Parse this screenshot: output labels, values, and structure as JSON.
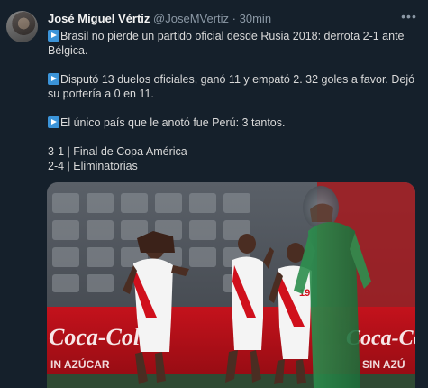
{
  "tweet": {
    "author_name": "José Miguel Vértiz",
    "author_handle": "@JoseMVertiz",
    "separator": "·",
    "timestamp": "30min",
    "more_icon": "more-icon",
    "paragraphs": [
      "Brasil no pierde un partido oficial desde Rusia 2018: derrota 2-1 ante Bélgica.",
      "Disputó 13 duelos oficiales, ganó 11 y empató 2. 32 goles a favor. Dejó su portería a 0 en 11.",
      "El único país que le anotó fue Perú: 3 tantos."
    ],
    "stats_lines": [
      "3-1 | Final de Copa América",
      "2-4 | Eliminatorias"
    ],
    "media": {
      "ad_text_left": "Coca-Cola",
      "ad_text_right": "Coca-Cola",
      "ad_sub_left": "IN AZÚCAR",
      "ad_sub_right": "SIN AZÚ",
      "jersey_number": "19"
    }
  },
  "colors": {
    "background": "#15202b",
    "text": "#d9d9d9",
    "secondary_text": "#8b98a5",
    "emoji_blue": "#3b94d9"
  }
}
